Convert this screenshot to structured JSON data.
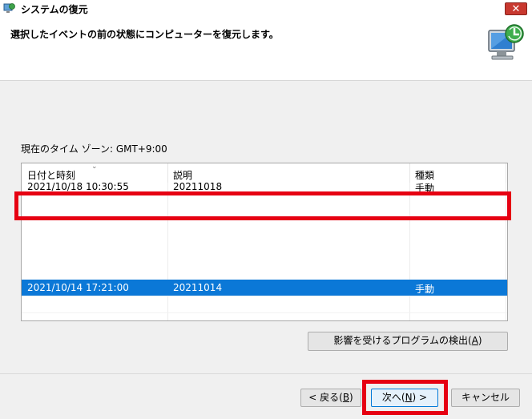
{
  "window": {
    "title": "システムの復元",
    "close_label": "✕"
  },
  "header": {
    "instruction": "選択したイベントの前の状態にコンピューターを復元します。"
  },
  "timezone_label": "現在のタイム ゾーン: GMT+9:00",
  "restore_points": {
    "columns": [
      "日付と時刻",
      "説明",
      "種類"
    ],
    "rows": [
      {
        "datetime": "2021/10/18 10:30:55",
        "description": "20211018",
        "type": "手動",
        "selected": false
      },
      {
        "datetime": "2021/10/14 17:21:00",
        "description": "20211014",
        "type": "手動",
        "selected": true
      }
    ]
  },
  "buttons": {
    "scan_prefix": "影響を受けるプログラムの検出(",
    "scan_key": "A",
    "scan_suffix": ")",
    "back_prefix": "< 戻る(",
    "back_key": "B",
    "back_suffix": ")",
    "next_prefix": "次へ(",
    "next_key": "N",
    "next_suffix": ") >",
    "cancel": "キャンセル"
  },
  "colors": {
    "selection": "#0b78d7",
    "highlight_box": "#e60012"
  }
}
